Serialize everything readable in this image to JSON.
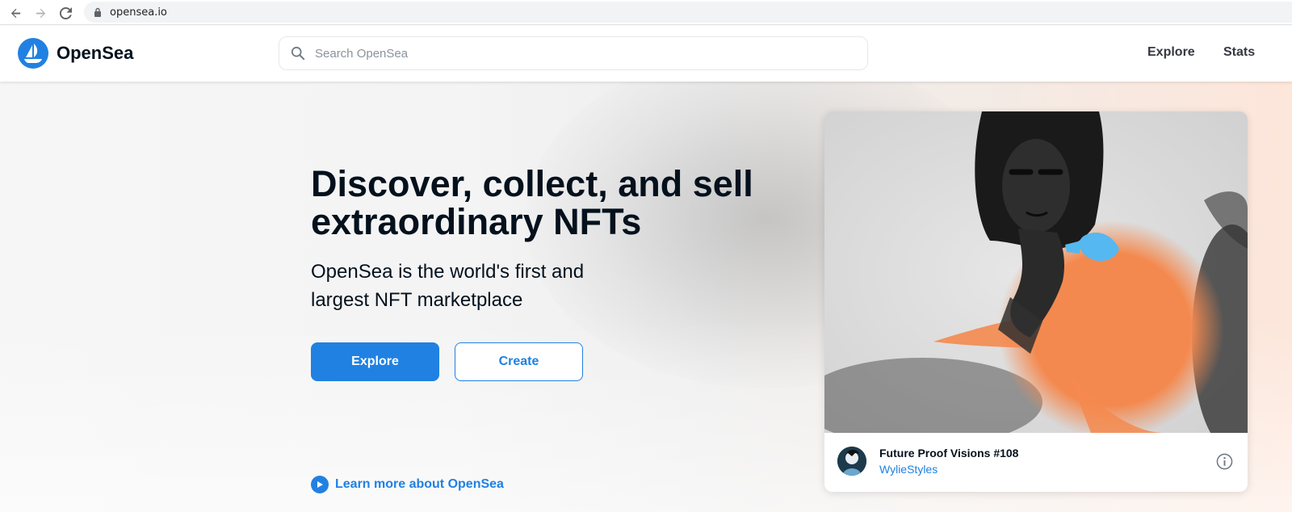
{
  "browser": {
    "url": "opensea.io"
  },
  "header": {
    "logo_text": "OpenSea",
    "search_placeholder": "Search OpenSea",
    "nav": [
      "Explore",
      "Stats"
    ]
  },
  "hero": {
    "headline": "Discover, collect, and sell extraordinary NFTs",
    "subline": "OpenSea is the world's first and largest NFT marketplace",
    "primary_button": "Explore",
    "secondary_button": "Create",
    "learn_more": "Learn more about OpenSea"
  },
  "featured": {
    "title": "Future Proof Visions #108",
    "creator": "WylieStyles"
  },
  "colors": {
    "accent": "#2081e2",
    "text": "#04111d",
    "art_orange": "#f4894f",
    "art_blue": "#55b8f0"
  }
}
